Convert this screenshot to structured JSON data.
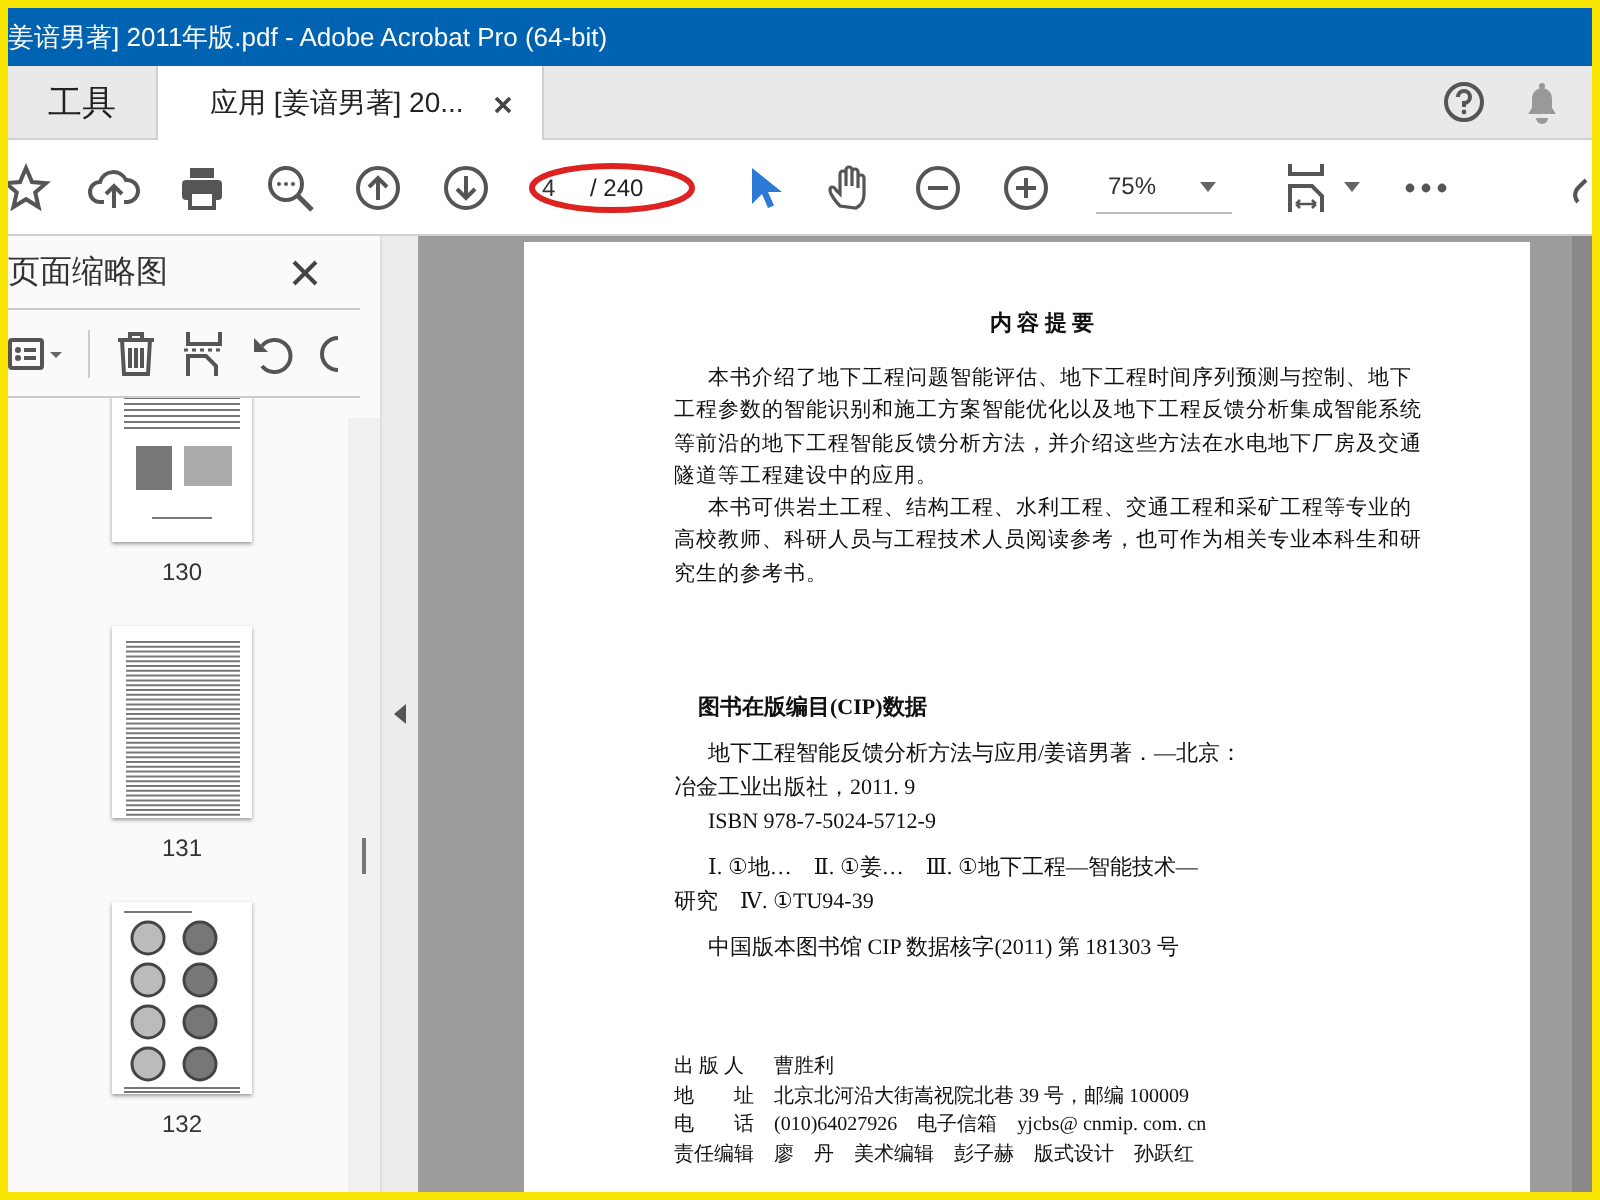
{
  "window": {
    "title": "姜谙男著] 2011年版.pdf - Adobe Acrobat Pro (64-bit)"
  },
  "tabs": [
    {
      "label": "工具",
      "selected": false,
      "closable": false
    },
    {
      "label": "应用 [姜谙男著] 20...",
      "selected": true,
      "closable": true
    }
  ],
  "toolbar": {
    "page_number": "4",
    "page_total": "/ 240",
    "zoom": "75%"
  },
  "thumbnails_panel": {
    "title": "页面缩略图",
    "pages": [
      {
        "label": "130",
        "kind": "figure"
      },
      {
        "label": "131",
        "kind": "text"
      },
      {
        "label": "132",
        "kind": "circles"
      }
    ]
  },
  "document": {
    "heading": "内 容 提 要",
    "summary_paragraphs": [
      [
        "本书介绍了地下工程问题智能评估、地下工程时间序列预测与控制、地下",
        "工程参数的智能识别和施工方案智能优化以及地下工程反馈分析集成智能系统",
        "等前沿的地下工程智能反馈分析方法，并介绍这些方法在水电地下厂房及交通",
        "隧道等工程建设中的应用。"
      ],
      [
        "本书可供岩土工程、结构工程、水利工程、交通工程和采矿工程等专业的",
        "高校教师、科研人员与工程技术人员阅读参考，也可作为相关专业本科生和研",
        "究生的参考书。"
      ]
    ],
    "cip_heading": "图书在版编目(CIP)数据",
    "cip_groups": [
      [
        {
          "text": "地下工程智能反馈分析方法与应用/姜谙男著．—北京：",
          "indent": true
        },
        {
          "text": "冶金工业出版社，2011. 9",
          "indent": false
        },
        {
          "text": "ISBN 978-7-5024-5712-9",
          "indent": true
        }
      ],
      [
        {
          "text": "Ⅰ. ①地…　Ⅱ. ①姜…　Ⅲ. ①地下工程—智能技术—",
          "indent": true
        },
        {
          "text": "研究　Ⅳ. ①TU94-39",
          "indent": false
        }
      ],
      [
        {
          "text": "中国版本图书馆 CIP 数据核字(2011) 第 181303 号",
          "indent": true
        }
      ]
    ],
    "imprint": [
      {
        "label": "出 版 人",
        "value": "曹胜利"
      },
      {
        "label": "地　　址",
        "value": "北京北河沿大街嵩祝院北巷 39 号，邮编 100009"
      },
      {
        "label": "电　　话",
        "value": "(010)64027926　电子信箱　yjcbs@ cnmip. com. cn"
      },
      {
        "label": "责任编辑",
        "value": "廖　丹　美术编辑　彭子赫　版式设计　孙跃红"
      }
    ]
  }
}
